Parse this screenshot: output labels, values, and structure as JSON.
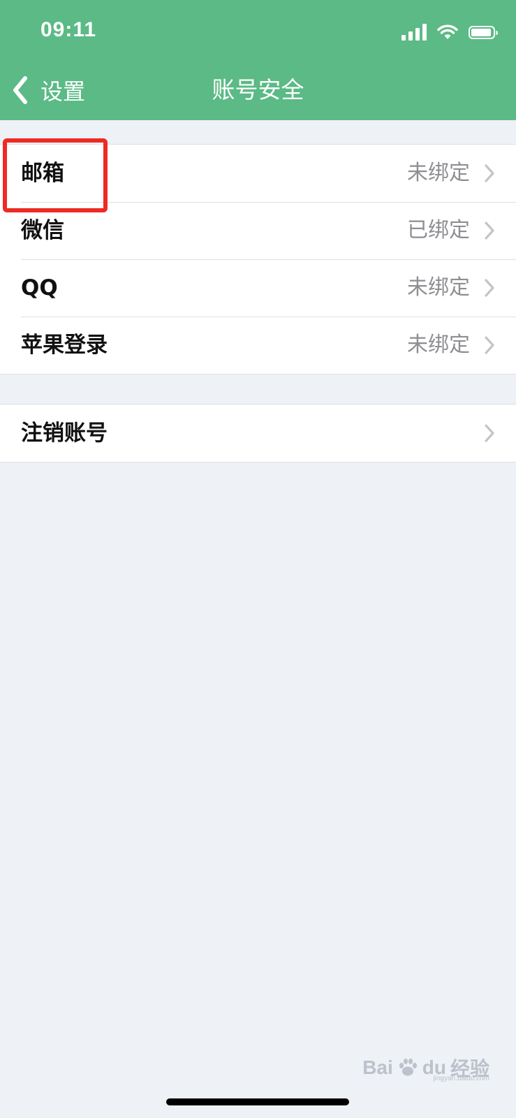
{
  "status_bar": {
    "time": "09:11",
    "icons": [
      "signal-icon",
      "wifi-icon",
      "battery-icon"
    ]
  },
  "nav": {
    "back_label": "设置",
    "title": "账号安全"
  },
  "bindings": [
    {
      "label": "邮箱",
      "status": "未绑定"
    },
    {
      "label": "微信",
      "status": "已绑定"
    },
    {
      "label": "QQ",
      "status": "未绑定"
    },
    {
      "label": "苹果登录",
      "status": "未绑定"
    }
  ],
  "account": {
    "delete_label": "注销账号"
  },
  "watermark": {
    "brand": "Bai",
    "brand2": "du",
    "suffix": "经验",
    "sub": "jingyan.baidu.com"
  },
  "colors": {
    "header": "#5bba85",
    "background": "#eef1f5",
    "highlight": "#ee2a24",
    "status_text": "#8e8e93"
  }
}
